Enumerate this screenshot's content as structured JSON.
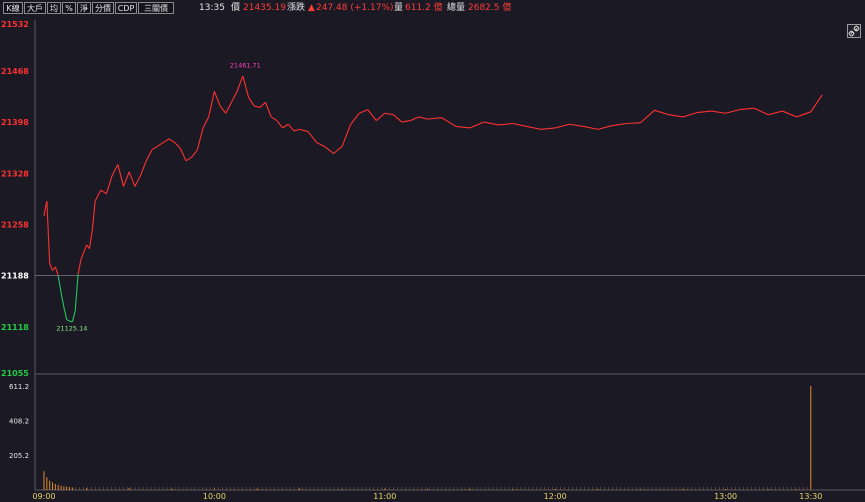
{
  "toolbar": {
    "buttons": [
      "K線",
      "大戶",
      "均",
      "%",
      "淨",
      "分價",
      "CDP",
      "三關價"
    ],
    "time": "13:35",
    "price_label": "價",
    "price": "21435.19",
    "change_label": "漲跌",
    "change_arrow": "▲",
    "change": "247.48 (+1.17%)",
    "volume_label": "量",
    "volume": "611.2 億",
    "total_label": "總量",
    "total": "2682.5 億"
  },
  "colors": {
    "background": "#1b1a24",
    "up": "#ff3030",
    "down": "#22c55e",
    "reference": "#ffffff",
    "volume": "#e08a2a",
    "high_label": "#ff40c0",
    "low_label": "#88ee88",
    "time_label": "#e8d36a"
  },
  "icons": {
    "fullscreen": "link-icon"
  },
  "chart_data": [
    {
      "type": "line",
      "reference": 21188,
      "ylim": [
        21055,
        21532
      ],
      "y_ticks": [
        "21532",
        "21468",
        "21398",
        "21328",
        "21258",
        "21188",
        "21118",
        "21055"
      ],
      "x_ticks": [
        "09:00",
        "10:00",
        "11:00",
        "12:00",
        "13:00",
        "13:30"
      ],
      "annotations": {
        "high": "21461.71",
        "low": "21125.14"
      },
      "series": [
        {
          "x": [
            "09:00",
            "09:01",
            "09:02",
            "09:03",
            "09:04",
            "09:05",
            "09:06",
            "09:07",
            "09:08",
            "09:09",
            "09:10",
            "09:11",
            "09:12",
            "09:13",
            "09:14",
            "09:15",
            "09:16",
            "09:17",
            "09:18",
            "09:20",
            "09:22",
            "09:24",
            "09:26",
            "09:28",
            "09:30",
            "09:32",
            "09:34",
            "09:36",
            "09:38",
            "09:40",
            "09:42",
            "09:44",
            "09:46",
            "09:48",
            "09:50",
            "09:52",
            "09:54",
            "09:56",
            "09:58",
            "10:00",
            "10:02",
            "10:04",
            "10:06",
            "10:08",
            "10:10",
            "10:12",
            "10:14",
            "10:16",
            "10:18",
            "10:20",
            "10:22",
            "10:24",
            "10:26",
            "10:28",
            "10:30",
            "10:33",
            "10:36",
            "10:39",
            "10:42",
            "10:45",
            "10:48",
            "10:51",
            "10:54",
            "10:57",
            "11:00",
            "11:03",
            "11:06",
            "11:09",
            "11:12",
            "11:15",
            "11:20",
            "11:25",
            "11:30",
            "11:35",
            "11:40",
            "11:45",
            "11:50",
            "11:55",
            "12:00",
            "12:05",
            "12:10",
            "12:15",
            "12:20",
            "12:25",
            "12:30",
            "12:35",
            "12:40",
            "12:45",
            "12:50",
            "12:55",
            "13:00",
            "13:05",
            "13:10",
            "13:15",
            "13:20",
            "13:25",
            "13:30",
            "13:34"
          ],
          "values": [
            21270,
            21290,
            21205,
            21195,
            21200,
            21188,
            21165,
            21145,
            21128,
            21126,
            21125,
            21140,
            21190,
            21210,
            21220,
            21230,
            21225,
            21250,
            21290,
            21305,
            21300,
            21325,
            21340,
            21310,
            21330,
            21310,
            21325,
            21345,
            21360,
            21365,
            21370,
            21375,
            21370,
            21362,
            21345,
            21350,
            21360,
            21390,
            21405,
            21440,
            21420,
            21410,
            21425,
            21440,
            21461,
            21432,
            21420,
            21418,
            21425,
            21405,
            21400,
            21390,
            21395,
            21386,
            21388,
            21385,
            21370,
            21364,
            21355,
            21365,
            21395,
            21410,
            21415,
            21400,
            21410,
            21408,
            21398,
            21400,
            21405,
            21402,
            21404,
            21392,
            21390,
            21398,
            21394,
            21396,
            21392,
            21388,
            21390,
            21395,
            21392,
            21388,
            21393,
            21396,
            21397,
            21414,
            21408,
            21405,
            21411,
            21413,
            21410,
            21415,
            21417,
            21408,
            21413,
            21405,
            21412,
            21435
          ]
        }
      ]
    },
    {
      "type": "bar",
      "ylim": [
        0,
        611.2
      ],
      "y_ticks": [
        "611.2",
        "408.2",
        "205.2"
      ],
      "series": [
        {
          "x": [
            "09:00",
            "09:01",
            "09:02",
            "09:03",
            "09:04",
            "09:05",
            "09:06",
            "09:07",
            "09:08",
            "09:09",
            "09:10",
            "09:15",
            "09:30",
            "09:45",
            "10:00",
            "10:15",
            "10:30",
            "10:45",
            "11:00",
            "11:15",
            "11:30",
            "11:45",
            "12:00",
            "12:15",
            "12:30",
            "12:45",
            "13:00",
            "13:15",
            "13:25",
            "13:30"
          ],
          "values": [
            110,
            75,
            55,
            45,
            35,
            30,
            25,
            22,
            20,
            18,
            15,
            10,
            12,
            8,
            10,
            8,
            9,
            7,
            8,
            6,
            7,
            6,
            6,
            5,
            5,
            5,
            6,
            5,
            4,
            611.2
          ]
        }
      ]
    }
  ]
}
